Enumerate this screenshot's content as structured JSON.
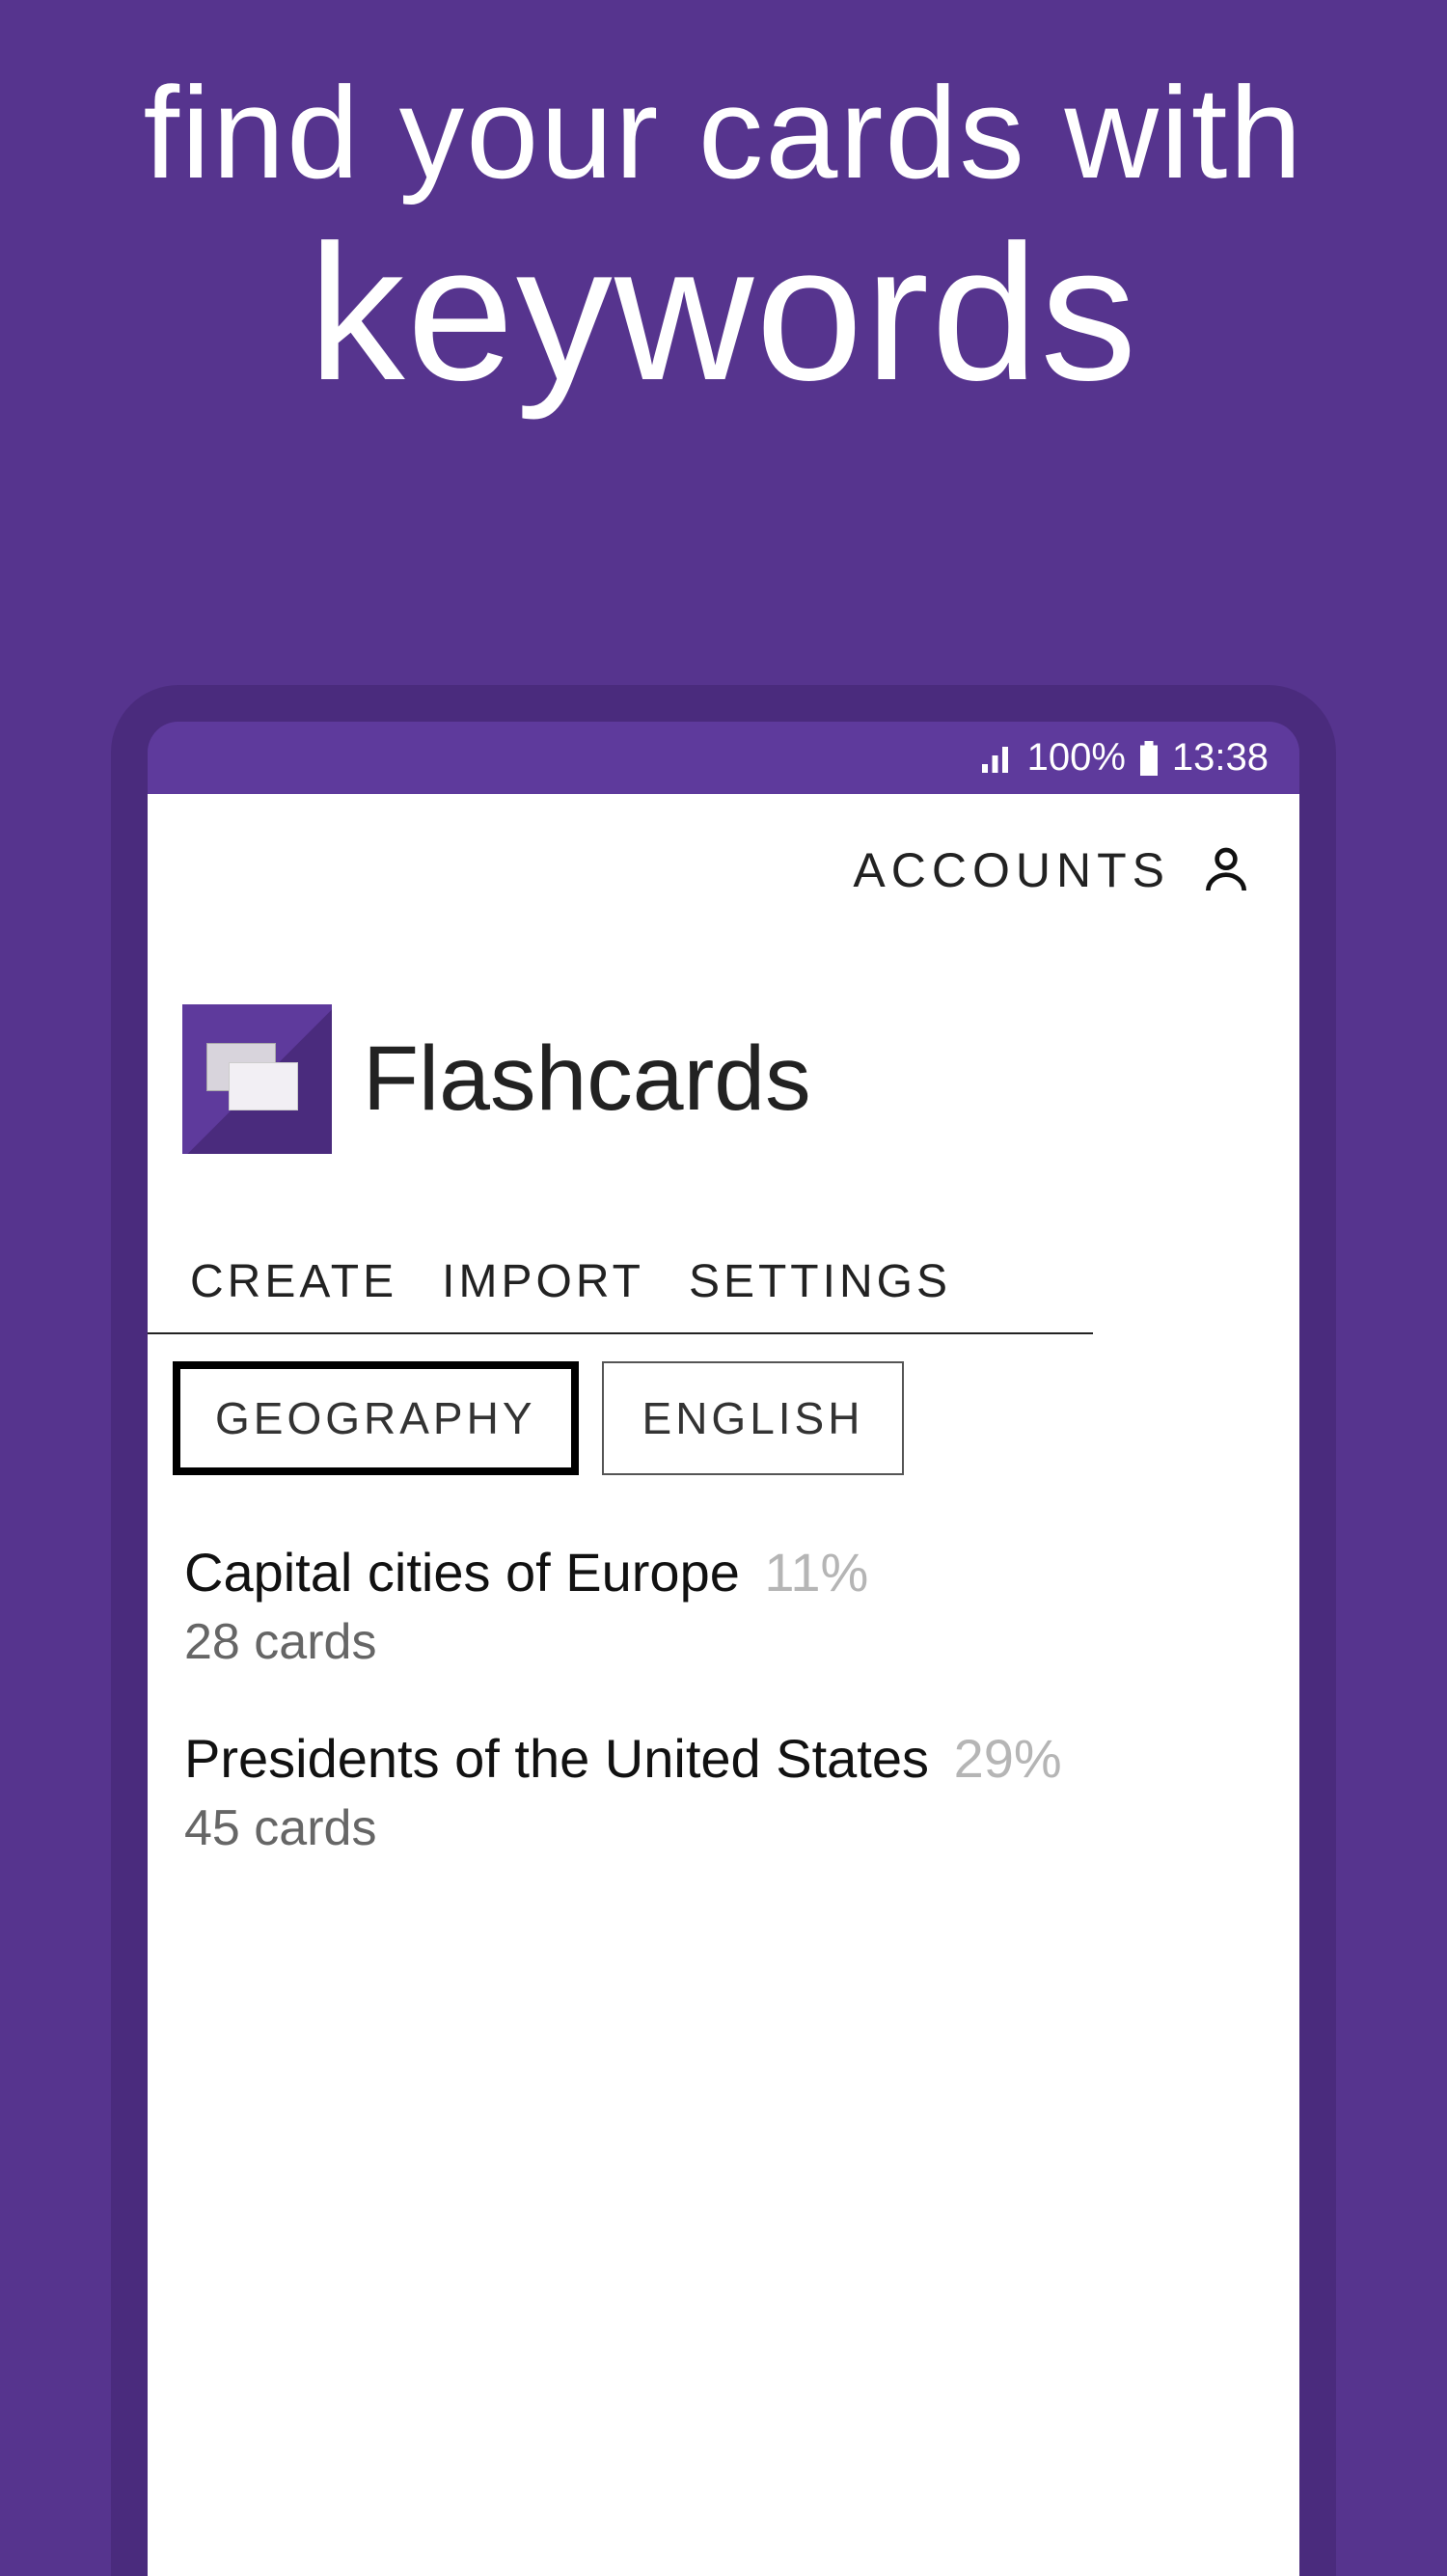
{
  "promo": {
    "line1": "find your cards with",
    "line2": "keywords"
  },
  "statusbar": {
    "battery": "100%",
    "time": "13:38"
  },
  "topbar": {
    "accounts": "ACCOUNTS"
  },
  "app": {
    "title": "Flashcards"
  },
  "menu": {
    "create": "CREATE",
    "import": "IMPORT",
    "settings": "SETTINGS"
  },
  "tags": [
    {
      "label": "GEOGRAPHY",
      "active": true
    },
    {
      "label": "ENGLISH",
      "active": false
    }
  ],
  "decks": [
    {
      "title": "Capital cities of Europe",
      "percent": "11%",
      "count": "28 cards"
    },
    {
      "title": "Presidents of the United States",
      "percent": "29%",
      "count": "45 cards"
    }
  ]
}
